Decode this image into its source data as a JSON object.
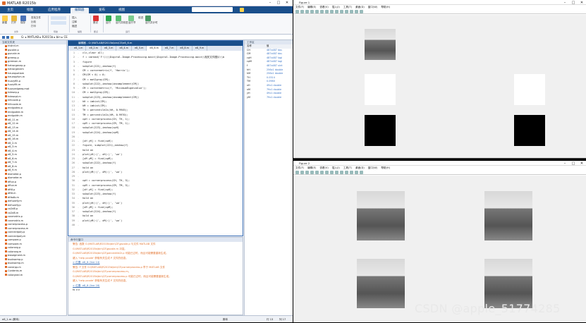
{
  "matlab": {
    "title": "MATLAB R2015b",
    "ribbon_tabs": [
      "主页",
      "绘图",
      "应用程序",
      "编辑器",
      "发布",
      "视图"
    ],
    "active_tab": "编辑器",
    "ribbon_buttons": [
      "新建",
      "打开",
      "保存",
      "查找文件",
      "比较",
      "打印",
      "插入",
      "注释",
      "缩进",
      "断点",
      "运行",
      "运行并前进",
      "运行节",
      "前进",
      "运行并计时"
    ],
    "ribbon_groups": [
      "文件",
      "导航",
      "编辑",
      "断点",
      "运行"
    ],
    "path": "G: ▸ MATLAB ▸ R2015b ▸ bin ▸ CE"
  },
  "folder": {
    "header": "当前文件夹",
    "files": [
      "histrct.m",
      "gscaler.p",
      "gsrcale.m",
      "greenp.p",
      "greenan.m",
      "hetrorgenep.p",
      "hetrorgenem",
      "heuequatiom",
      "heuequfsm.m",
      "huzzyfilt.p",
      "fuzzyfilt.m",
      "fuzzyedgeeq.mat",
      "hdesep.p",
      "hdesept.m",
      "hlfccode.p",
      "hlfccode.m",
      "endgudeo.p",
      "endgudee.m",
      "endguidn.m",
      "e8_11.m",
      "e8_12.m",
      "e8_13.m",
      "e8_14.m",
      "e8_15.m",
      "e8_16.m",
      "e8_2.m",
      "e8_3.m",
      "e8_4.m",
      "e8_5.m",
      "e8_6.m",
      "e8_7.m",
      "e8_8.m",
      "e8_9.m",
      "diameter.p",
      "diameter.m",
      "dftuv.p",
      "dftuv.m",
      "dft8.p",
      "dft8.m",
      "dtfadb.m",
      "defuzzify.m",
      "defuzzify.p",
      "co2d8.p",
      "co2d8.m",
      "covmatrix.p",
      "covmatrix.m",
      "cornerprocess.p",
      "cornerprocess.m",
      "connectpoly.p",
      "connectpoly.m",
      "compare.p",
      "compare.m",
      "colorseg.p",
      "colorseg.m",
      "bwsegment.m",
      "bsubsamp.p",
      "bsubsamp.m",
      "conerpp.m",
      "Contents.m",
      "colorgrad.m"
    ],
    "selected": "e8_1.m",
    "footer": "e8_1.m (脚本)"
  },
  "editor": {
    "title": "编辑器 - G:\\MATLAB\\R2015b\\bin\\CE\\e8_6.m",
    "tabs": [
      "e8_1.m",
      "e8_2.m",
      "e8_3.m",
      "e8_4.m",
      "e8_5.m",
      "e8_6.m",
      "e8_7.m",
      "e8_8.m",
      "e8_9.m"
    ],
    "active_tab": "e8_6.m",
    "lines": [
      {
        "n": "1",
        "code": "clc,clear all;"
      },
      {
        "n": "2",
        "code": "f = imread('F:\\\\\\\\Digital-Image-Processing-main\\\\Digital-Image-Processing-main\\\\相关文件图片\\\\b"
      },
      {
        "n": "3",
        "code": "figure"
      },
      {
        "n": "4",
        "code": "subplot(221),imshow(f)"
      },
      {
        "n": "5",
        "code": "CM = cornermetric(f, 'Harris');"
      },
      {
        "n": "6",
        "code": "CM(CM < 0) = 0;"
      },
      {
        "n": "7",
        "code": "CM = mat2gray(CM);"
      },
      {
        "n": "8",
        "code": "subplot(222),imshow(imcomplement(CM))"
      },
      {
        "n": "9",
        "code": "CM = cornermetric(f, 'MinimumEigenvalue');"
      },
      {
        "n": "10",
        "code": "CM = mat2gray(CM);"
      },
      {
        "n": "11",
        "code": "subplot(223),imshow(imcomplement(CM))"
      },
      {
        "n": "12",
        "code": "hH = imhist(CM);"
      },
      {
        "n": "13",
        "code": "hM = imhist(CM);"
      },
      {
        "n": "14",
        "code": "TH = percentile2i(hH, 0.9945);"
      },
      {
        "n": "15",
        "code": "TM = percentile2i(hM, 0.9970);"
      },
      {
        "n": "16",
        "code": "cpH = cornerprocess(CH, TH, 1);"
      },
      {
        "n": "17",
        "code": "cpM = cornerprocess(CM, TM, 1);"
      },
      {
        "n": "18",
        "code": "subplot(223),imshow(cpH)"
      },
      {
        "n": "19",
        "code": "subplot(224),imshow(cpM)"
      },
      {
        "n": "20",
        "code": ""
      },
      {
        "n": "21",
        "code": "[xH yH] = find(cpH);"
      },
      {
        "n": "22",
        "code": "figure, subplot(221),imshow(f)"
      },
      {
        "n": "23",
        "code": "hold on"
      },
      {
        "n": "24",
        "code": "plot(yH(:)', xH(:)', 'wo')"
      },
      {
        "n": "25",
        "code": "[xM yM] = find(cpM);"
      },
      {
        "n": "26",
        "code": "subplot(222),imshow(f)"
      },
      {
        "n": "27",
        "code": "hold on"
      },
      {
        "n": "28",
        "code": "plot(yM(:)', xM(:)', 'wo')"
      },
      {
        "n": "29",
        "code": ""
      },
      {
        "n": "30",
        "code": "cpH = cornerprocess(CH, TH, 5);"
      },
      {
        "n": "31",
        "code": "cpM = cornerprocess(CM, TM, 5);"
      },
      {
        "n": "32",
        "code": "[xH yH] = find(cpH);"
      },
      {
        "n": "33",
        "code": "subplot(223),imshow(f)"
      },
      {
        "n": "34",
        "code": "hold on"
      },
      {
        "n": "35",
        "code": "plot(yH(:)', xH(:)', 'wo')"
      },
      {
        "n": "36",
        "code": "[xM yM] = find(cpM);"
      },
      {
        "n": "37",
        "code": "subplot(224),imshow(f)"
      },
      {
        "n": "38",
        "code": "hold on"
      },
      {
        "n": "39",
        "code": "plot(yM(:)', xM(:)', 'wo')"
      },
      {
        "n": "40",
        "code": ""
      }
    ]
  },
  "workspace": {
    "header": "工作区",
    "col_name": "名称",
    "col_value": "值",
    "vars": [
      {
        "name": "CH",
        "value": "487x487 dou"
      },
      {
        "name": "CM",
        "value": "487x487 dou"
      },
      {
        "name": "cpH",
        "value": "487x487 logi"
      },
      {
        "name": "cpM",
        "value": "487x487 logi"
      },
      {
        "name": "f",
        "value": "487x487 uint"
      },
      {
        "name": "hH",
        "value": "256x1 double"
      },
      {
        "name": "hM",
        "value": "256x1 double"
      },
      {
        "name": "TH",
        "value": "0.0314"
      },
      {
        "name": "TM",
        "value": "0.0980"
      },
      {
        "name": "xH",
        "value": "49x1 double"
      },
      {
        "name": "xM",
        "value": "79x1 double"
      },
      {
        "name": "yH",
        "value": "49x1 double"
      },
      {
        "name": "yM",
        "value": "79x1 double"
      }
    ]
  },
  "command": {
    "header": "命令行窗口",
    "lines": [
      {
        "t": "警告: 函数 G:\\MATLAB\\R2015b\\bin\\CE\\gscale.p 与文件 MATLAB 文件",
        "k": "w"
      },
      {
        "t": "G:\\MATLAB\\R2015b\\bin\\CE\\gscale.m 冲突。",
        "k": "w"
      },
      {
        "t": "G:\\MATLAB\\R2015b\\bin\\CE\\percentile2i.p 可能已过时，而且可能需要重新生成。",
        "k": "w"
      },
      {
        "t": "键入 'help pcode' 获取有关生成 P 文件的信息。",
        "k": "w"
      },
      {
        "t": "> 位置: e8_6 (line 14)",
        "k": "u"
      },
      {
        "t": "警告: P 文件 G:\\MATLAB\\R2015b\\bin\\CE\\cornerprocess.p 早于 MATLAB 文件",
        "k": "w"
      },
      {
        "t": "G:\\MATLAB\\R2015b\\bin\\CE\\cornerprocess.m。",
        "k": "w"
      },
      {
        "t": "G:\\MATLAB\\R2015b\\bin\\CE\\cornerprocess.p 可能已过时，而且可能需要重新生成。",
        "k": "w"
      },
      {
        "t": "键入 'help pcode' 获取有关生成 P 文件的信息。",
        "k": "w"
      },
      {
        "t": "> 位置: e8_6 (line 16)",
        "k": "u"
      },
      {
        "t": "fx >>",
        "k": "k"
      }
    ]
  },
  "status": {
    "mode": "脚本",
    "ln": "行 13",
    "col": "列 17"
  },
  "figure1": {
    "title": "Figure 1",
    "menu": [
      "文件(F)",
      "编辑(E)",
      "查看(V)",
      "插入(I)",
      "工具(T)",
      "桌面(D)",
      "窗口(W)",
      "帮助(H)"
    ]
  },
  "figure2": {
    "title": "Figure 2",
    "menu": [
      "文件(F)",
      "编辑(E)",
      "查看(V)",
      "插入(I)",
      "工具(T)",
      "桌面(D)",
      "窗口(W)",
      "帮助(H)"
    ]
  },
  "watermark": "CSDN @apple_51774285",
  "colors": {
    "accent": "#1a4f8b",
    "warning": "#e2732f",
    "link": "#3b6fb5"
  }
}
